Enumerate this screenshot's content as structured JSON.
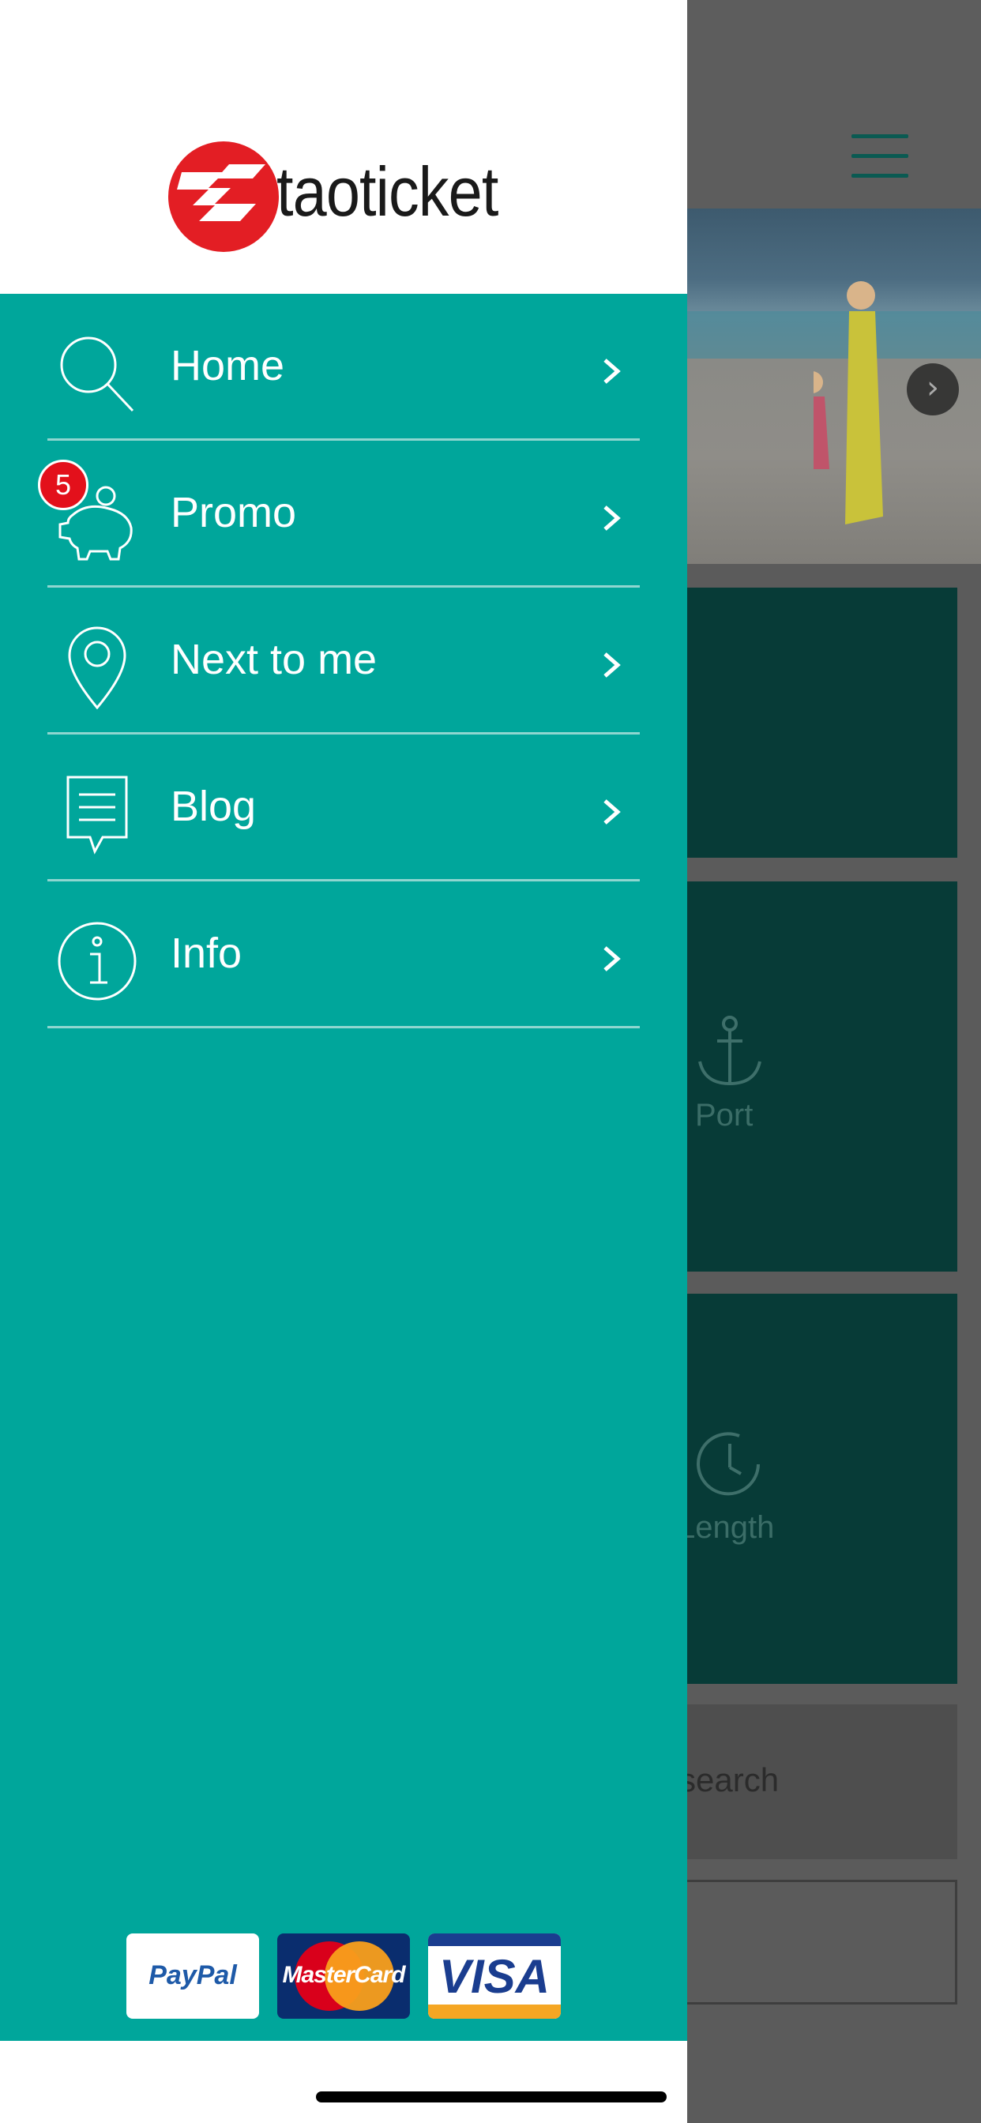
{
  "app": {
    "brand": "taoticket"
  },
  "menu": {
    "items": [
      {
        "label": "Home",
        "icon": "search-icon"
      },
      {
        "label": "Promo",
        "icon": "piggy-bank-icon",
        "badge": "5"
      },
      {
        "label": "Next to me",
        "icon": "map-pin-icon"
      },
      {
        "label": "Blog",
        "icon": "speech-bubble-icon"
      },
      {
        "label": "Info",
        "icon": "info-icon"
      }
    ]
  },
  "payments": {
    "paypal": "PayPal",
    "mastercard": "MasterCard",
    "visa": "VISA"
  },
  "background": {
    "port_label": "Port",
    "length_label": "Length",
    "search_label": "search"
  },
  "colors": {
    "drawer": "#00a69b",
    "badge": "#e3101b",
    "logo": "#e31e24",
    "divider": "#8fd6d0"
  }
}
